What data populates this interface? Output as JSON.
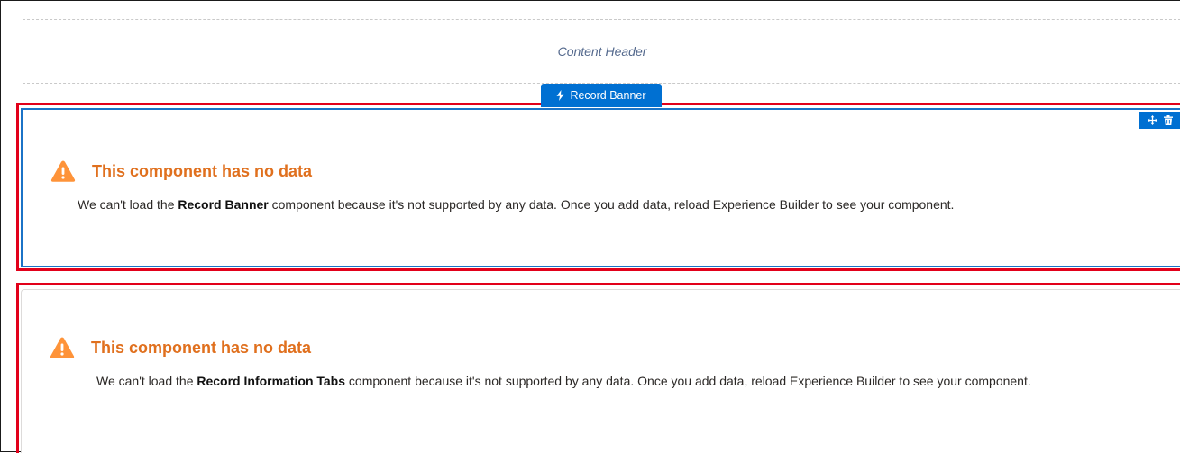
{
  "content_header": {
    "label": "Content Header"
  },
  "selected_component_tab": {
    "label": "Record Banner",
    "icon": "lightning-bolt-icon"
  },
  "component_toolbar": {
    "move_icon": "move-icon",
    "delete_icon": "trash-icon"
  },
  "components": [
    {
      "title": "This component has no data",
      "message_prefix": "We can't load the ",
      "component_name": "Record Banner",
      "message_suffix": " component because it's not supported by any data. Once you add data, reload Experience Builder to see your component."
    },
    {
      "title": "This component has no data",
      "message_prefix": "We can't load the ",
      "component_name": "Record Information Tabs",
      "message_suffix": " component because it's not supported by any data. Once you add data, reload Experience Builder to see your component."
    }
  ],
  "colors": {
    "selection_blue": "#0070d2",
    "warning_orange": "#e0701e",
    "highlight_red": "#e2001a"
  }
}
